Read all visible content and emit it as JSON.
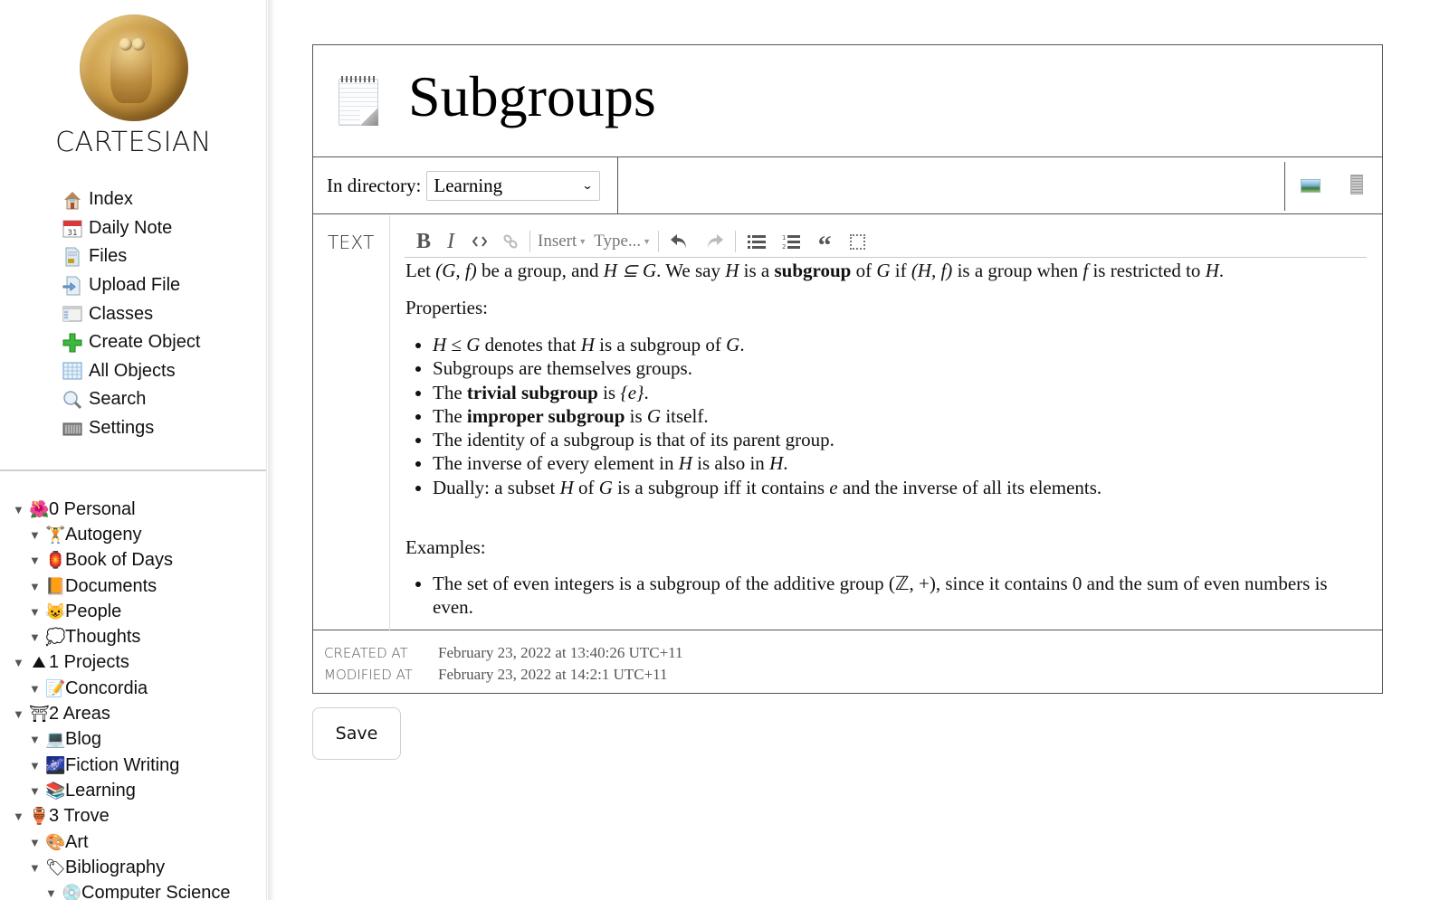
{
  "sidebar": {
    "brand": "CARTESIAN",
    "logo": "owl-coin-logo",
    "nav": [
      {
        "label": "Index",
        "icon": "house-icon"
      },
      {
        "label": "Daily Note",
        "icon": "calendar-icon",
        "icon_text": "31"
      },
      {
        "label": "Files",
        "icon": "document-icon"
      },
      {
        "label": "Upload File",
        "icon": "upload-icon"
      },
      {
        "label": "Classes",
        "icon": "window-icon"
      },
      {
        "label": "Create Object",
        "icon": "plus-icon"
      },
      {
        "label": "All Objects",
        "icon": "grid-icon"
      },
      {
        "label": "Search",
        "icon": "magnifier-icon"
      },
      {
        "label": "Settings",
        "icon": "keyboard-icon"
      }
    ],
    "tree": [
      {
        "label": "0 Personal",
        "emoji": "🌺",
        "level": 0
      },
      {
        "label": "Autogeny",
        "emoji": "🏋",
        "level": 1
      },
      {
        "label": "Book of Days",
        "emoji": "🏮",
        "level": 1
      },
      {
        "label": "Documents",
        "emoji": "📙",
        "level": 1
      },
      {
        "label": "People",
        "emoji": "😺",
        "level": 1
      },
      {
        "label": "Thoughts",
        "emoji": "💭",
        "level": 1
      },
      {
        "label": "1 Projects",
        "emoji": "⛰",
        "level": 0
      },
      {
        "label": "Concordia",
        "emoji": "📝",
        "level": 1
      },
      {
        "label": "2 Areas",
        "emoji": "⛩",
        "level": 0
      },
      {
        "label": "Blog",
        "emoji": "💻",
        "level": 1
      },
      {
        "label": "Fiction Writing",
        "emoji": "🌌",
        "level": 1
      },
      {
        "label": "Learning",
        "emoji": "📚",
        "level": 1
      },
      {
        "label": "3 Trove",
        "emoji": "🏺",
        "level": 0
      },
      {
        "label": "Art",
        "emoji": "🎨",
        "level": 1
      },
      {
        "label": "Bibliography",
        "emoji": "🏷",
        "level": 1
      },
      {
        "label": "Computer Science",
        "emoji": "💿",
        "level": 2
      }
    ],
    "toggle_glyph": "▼"
  },
  "page": {
    "title": "Subgroups",
    "directory_label": "In directory:",
    "directory_value": "Learning",
    "field_label": "TEXT",
    "toolbar": {
      "bold": "B",
      "italic": "I",
      "code": "<>",
      "link": "🔗",
      "insert": "Insert",
      "type": "Type...",
      "undo": "↶",
      "redo": "↷",
      "quote": "“"
    },
    "content": {
      "intro": {
        "t1": "Let ",
        "m1": "(G, f)",
        "t2": " be a group, and ",
        "m2": "H ⊆ G",
        "t3": ". We say ",
        "m3": "H",
        "t4": " is a ",
        "b1": "subgroup",
        "t5": " of ",
        "m4": "G",
        "t6": " if ",
        "m5": "(H, f)",
        "t7": " is a group when ",
        "m6": "f",
        "t8": " is restricted to ",
        "m7": "H",
        "t9": "."
      },
      "properties_heading": "Properties:",
      "properties": {
        "p1": {
          "m1": "H ≤ G",
          "t1": " denotes that ",
          "m2": "H",
          "t2": " is a subgroup of ",
          "m3": "G",
          "t3": "."
        },
        "p2": {
          "t1": "Subgroups are themselves groups."
        },
        "p3": {
          "t1": "The ",
          "b1": "trivial subgroup",
          "t2": " is ",
          "m1": "{e}",
          "t3": "."
        },
        "p4": {
          "t1": "The ",
          "b1": "improper subgroup",
          "t2": " is ",
          "m1": "G",
          "t3": " itself."
        },
        "p5": {
          "t1": "The identity of a subgroup is that of its parent group."
        },
        "p6": {
          "t1": "The inverse of every element in ",
          "m1": "H",
          "t2": " is also in ",
          "m2": "H",
          "t3": "."
        },
        "p7": {
          "t1": "Dually: a subset ",
          "m1": "H",
          "t2": " of ",
          "m2": "G",
          "t3": " is a subgroup iff it contains ",
          "m3": "e",
          "t4": " and the inverse of all its elements."
        }
      },
      "examples_heading": "Examples:",
      "examples": {
        "e1": {
          "t1": "The set of even integers is a subgroup of the additive group ",
          "m1": "(ℤ, +)",
          "t2": ", since it contains 0 and the sum of even numbers is even."
        }
      }
    },
    "meta": {
      "created_label": "CREATED AT",
      "created_value": "February 23, 2022 at 13:40:26 UTC+11",
      "modified_label": "MODIFIED AT",
      "modified_value": "February 23, 2022 at 14:2:1 UTC+11"
    },
    "save_label": "Save"
  }
}
